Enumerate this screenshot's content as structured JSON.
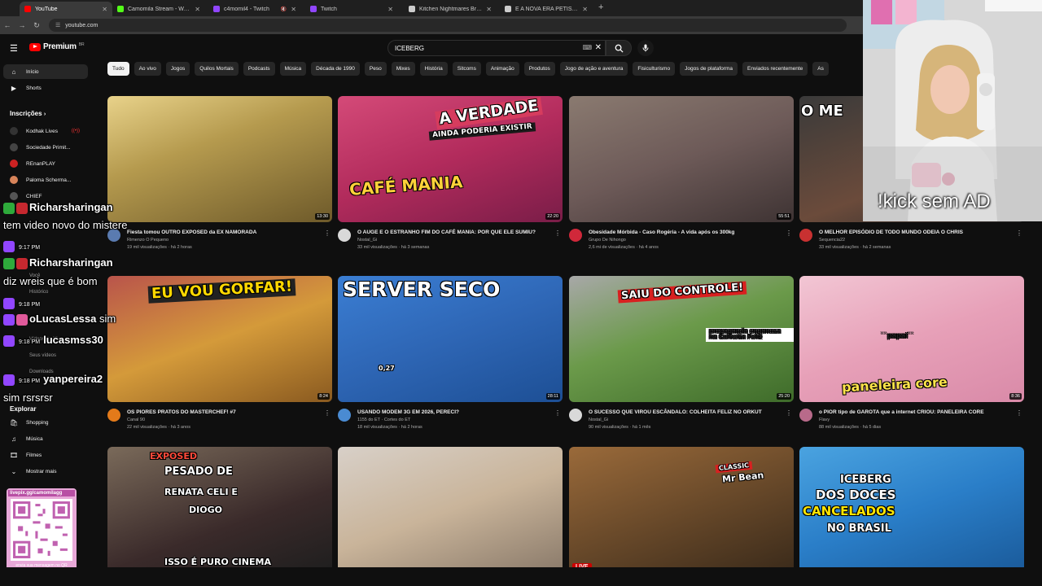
{
  "browser": {
    "tabs": [
      {
        "title": "YouTube",
        "favicon_color": "#ff0000",
        "active": true
      },
      {
        "title": "Camomila Stream - Watch Live",
        "favicon_color": "#53fc18",
        "active": false
      },
      {
        "title": "c4momil4 - Twitch",
        "favicon_color": "#9146ff",
        "active": false,
        "muted": true
      },
      {
        "title": "Twitch",
        "favicon_color": "#9146ff",
        "active": false
      },
      {
        "title": "Kitchen Nightmares Brazil - Hell",
        "favicon_color": "#cccccc",
        "active": false
      },
      {
        "title": "É A NOVA ERA PETISTA SAFADA",
        "favicon_color": "#cccccc",
        "active": false
      }
    ],
    "new_tab": "+",
    "url": "youtube.com"
  },
  "header": {
    "logo_text": "Premium",
    "logo_sup": "BR",
    "search_value": "ICEBERG",
    "search_icon": "search-icon",
    "mic_icon": "mic-icon"
  },
  "chips": [
    "Tudo",
    "Ao vivo",
    "Jogos",
    "Quilos Mortais",
    "Podcasts",
    "Música",
    "Década de 1990",
    "Peso",
    "Mixes",
    "História",
    "Sitcoms",
    "Animação",
    "Produtos",
    "Jogo de ação e aventura",
    "Fisiculturismo",
    "Jogos de plataforma",
    "Enviados recentemente",
    "As"
  ],
  "sidebar": {
    "home": "Início",
    "shorts": "Shorts",
    "subs_header": "Inscrições",
    "subs": [
      {
        "name": "Kodhak Lives",
        "color": "#333333",
        "live": true
      },
      {
        "name": "Sociedade Primit...",
        "color": "#444444",
        "live": false
      },
      {
        "name": "REnanPLAY",
        "color": "#cc2222",
        "live": false
      },
      {
        "name": "Paloma Scherma...",
        "color": "#d8845a",
        "live": false
      },
      {
        "name": "CHIEF",
        "color": "#555555",
        "live": false
      }
    ],
    "partial_labels": [
      "Você",
      "Histórico",
      "Vídeos do \"Gos...",
      "Seus vídeos",
      "Downloads"
    ],
    "explore_header": "Explorar",
    "explore": [
      "Shopping",
      "Música",
      "Filmes",
      "Mostrar mais"
    ]
  },
  "videos": [
    {
      "title": "Fiesta tomou OUTRO EXPOSED da EX NAMORADA",
      "channel": "Rimenzo O Pequeno",
      "stats": "19 mil visualizações · há 2 horas",
      "duration": "13:30",
      "avatar": "#5a7bb0",
      "thumb_bg": "linear-gradient(160deg,#e8d28a 0%,#b59a4e 40%,#6e5a2a 100%)"
    },
    {
      "title": "O AUGE E O ESTRANHO FIM DO CAFÉ MANIA: POR QUE ELE SUMIU?",
      "channel": "Nostal_Gi",
      "stats": "33 mil visualizações · há 3 semanas",
      "duration": "22:20",
      "avatar": "#d9d9d9",
      "thumb_bg": "linear-gradient(160deg,#d44a78 0%,#b22b5c 50%,#7a1d48 100%)",
      "thumb_texts": [
        "A VERDADE",
        "AINDA PODERIA EXISTIR",
        "CAFÉ MANIA"
      ]
    },
    {
      "title": "Obesidade Mórbida - Caso Rogéria - A vida após os 300kg",
      "channel": "Grupo De Nihongo",
      "stats": "2,6 mi de visualizações · há 4 anos",
      "duration": "55:51",
      "avatar": "#d0283a",
      "thumb_bg": "linear-gradient(160deg,#8a7a70 0%,#6d5a58 50%,#3e3333 100%)"
    },
    {
      "title": "O MELHOR EPISÓDIO DE TODO MUNDO ODEIA O CHRIS",
      "channel": "Sequencia22",
      "stats": "33 mil visualizações · há 2 semanas",
      "duration": "6:34",
      "avatar": "#c83131",
      "thumb_bg": "linear-gradient(160deg,#3a3a3a 0%,#6b4b3b 60%,#2a2a2a 100%)",
      "thumb_texts": [
        "O ME"
      ]
    },
    {
      "title": "OS PIORES PRATOS DO MASTERCHEF! #7",
      "channel": "Canal 90",
      "stats": "22 mil visualizações · há 3 anos",
      "duration": "8:24",
      "avatar": "#e37a1a",
      "thumb_bg": "linear-gradient(160deg,#b9544b 0%,#d49a3a 50%,#8a5a20 100%)",
      "thumb_texts": [
        "EU VOU GORFAR!"
      ]
    },
    {
      "title": "USANDO MODEM 3G EM 2026, PERECI?",
      "channel": "1155 do ET · Cortes do ET",
      "stats": "18 mil visualizações · há 2 horas",
      "duration": "28:11",
      "avatar": "#4a8bd2",
      "thumb_bg": "linear-gradient(160deg,#3b7ed3 0%,#2e66b5 50%,#1d4f95 100%)",
      "thumb_texts": [
        "SERVER SECO",
        "0,27"
      ]
    },
    {
      "title": "O SUCESSO QUE VIROU ESCÂNDALO: COLHEITA FELIZ NO ORKUT",
      "channel": "Nostal_Gi",
      "stats": "90 mil visualizações · há 1 mês",
      "duration": "25:20",
      "avatar": "#d9d9d9",
      "thumb_bg": "linear-gradient(160deg,#a8a8a8 0%,#6b9a4a 45%,#3e6b2a 100%)",
      "thumb_texts": [
        "SAIU DO CONTROLE!",
        "propaganda enganosa na Colheita Feliz"
      ]
    },
    {
      "title": "o PIOR tipo de GAROTA que a internet CRIOU: PANELEIRA CORE",
      "channel": "Flavy",
      "stats": "88 mil visualizações · há 5 dias",
      "duration": "8:36",
      "avatar": "#b86a8a",
      "thumb_bg": "linear-gradient(160deg,#f2c6d4 0%,#e7a0b8 50%,#d98aa8 100%)",
      "thumb_texts": [
        "``papai``",
        "paneleira core"
      ]
    },
    {
      "title": "",
      "channel": "",
      "stats": "",
      "duration": "",
      "avatar": "#444444",
      "thumb_bg": "linear-gradient(160deg,#7a6a5a 0%,#3a2a2a 60%,#1e1e1e 100%)",
      "thumb_texts": [
        "EXPOSED",
        "PESADO DE",
        "RENATA CELI E",
        "DIOGO",
        "ISSO É PURO CINEMA"
      ]
    },
    {
      "title": "",
      "channel": "",
      "stats": "",
      "duration": "",
      "avatar": "#444444",
      "thumb_bg": "linear-gradient(160deg,#d8d0c8 0%,#c9b49a 50%,#8a7a6a 100%)"
    },
    {
      "title": "",
      "channel": "",
      "stats": "",
      "duration": "",
      "avatar": "#444444",
      "thumb_bg": "linear-gradient(160deg,#9a6a3a 0%,#6a4a2a 50%,#3a2a1a 100%)",
      "live": "LIVE",
      "thumb_texts": [
        "CLASSIC",
        "Mr Bean"
      ]
    },
    {
      "title": "",
      "channel": "",
      "stats": "",
      "duration": "",
      "avatar": "#444444",
      "thumb_bg": "linear-gradient(160deg,#4aa3e0 0%,#2a7ec8 50%,#1a5a9a 100%)",
      "thumb_texts": [
        "ICEBERG",
        "DOS DOCES",
        "CANCELADOS",
        "NO BRASIL"
      ]
    }
  ],
  "webcam": {
    "overlay_text": "!kick sem AD"
  },
  "chat": [
    {
      "type": "name",
      "name": "Richarsharingan",
      "badges": [
        "bg-green",
        "bg-red"
      ]
    },
    {
      "type": "msg",
      "text": "tem video novo do mistere"
    },
    {
      "type": "time",
      "time": "9:17 PM"
    },
    {
      "type": "name",
      "name": "Richarsharingan",
      "badges": [
        "bg-green",
        "bg-red"
      ]
    },
    {
      "type": "msg",
      "text": "diz wreis que é bom"
    },
    {
      "type": "time",
      "time": "9:18 PM"
    },
    {
      "type": "inline",
      "name": "oLucasLessa",
      "text": "sim",
      "badges": [
        "bg-purple",
        "bg-pink"
      ]
    },
    {
      "type": "inline",
      "name": "lucasmss30",
      "text": "",
      "time": "9:18 PM",
      "badges": [
        "bg-purple"
      ]
    },
    {
      "type": "inline",
      "name": "yanpereira2",
      "text": "",
      "time": "9:18 PM",
      "badges": [
        "bg-purple"
      ]
    },
    {
      "type": "msg",
      "text": "sim rsrsrsr"
    }
  ],
  "qr": {
    "url": "livepix.gg/camomilagg",
    "caption": "envia sua mensagem no QR"
  },
  "colors": {
    "yt_red": "#ff0000",
    "bg": "#0f0f0f",
    "chip_bg": "#272727"
  }
}
